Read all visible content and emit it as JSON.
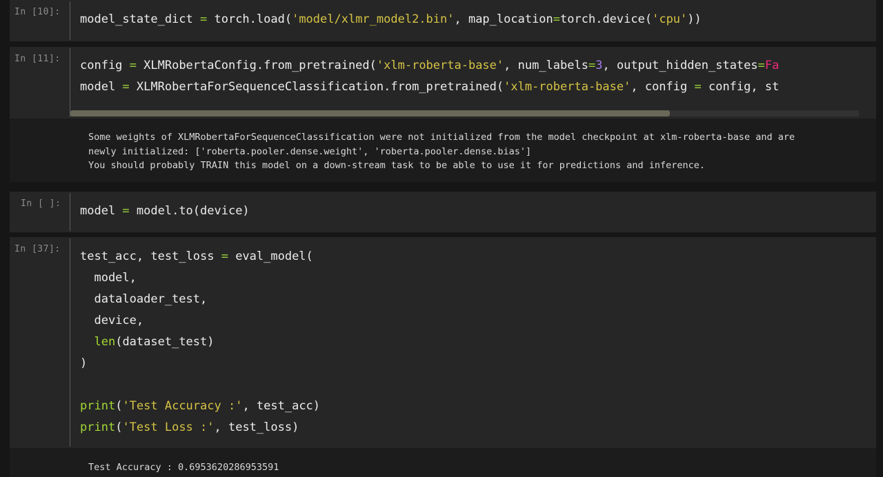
{
  "cells": [
    {
      "prompt": "In [10]:",
      "lines": [
        [
          [
            "t",
            "model_state_dict "
          ],
          [
            "op",
            "="
          ],
          [
            "t",
            " torch.load("
          ],
          [
            "str",
            "'model/xlmr_model2.bin'"
          ],
          [
            "t",
            ", map_location"
          ],
          [
            "op",
            "="
          ],
          [
            "t",
            "torch.device("
          ],
          [
            "str",
            "'cpu'"
          ],
          [
            "t",
            "))"
          ]
        ]
      ]
    },
    {
      "prompt": "In [11]:",
      "lines": [
        [
          [
            "t",
            "config "
          ],
          [
            "op",
            "="
          ],
          [
            "t",
            " XLMRobertaConfig.from_pretrained("
          ],
          [
            "str",
            "'xlm-roberta-base'"
          ],
          [
            "t",
            ", num_labels"
          ],
          [
            "op",
            "="
          ],
          [
            "num",
            "3"
          ],
          [
            "t",
            ", output_hidden_states"
          ],
          [
            "op",
            "="
          ],
          [
            "kw",
            "Fa"
          ]
        ],
        [
          [
            "t",
            "model "
          ],
          [
            "op",
            "="
          ],
          [
            "t",
            " XLMRobertaForSequenceClassification.from_pretrained("
          ],
          [
            "str",
            "'xlm-roberta-base'"
          ],
          [
            "t",
            ", config "
          ],
          [
            "op",
            "="
          ],
          [
            "t",
            " config, st"
          ]
        ]
      ],
      "scrollbar_fraction": 0.76,
      "output": [
        "Some weights of XLMRobertaForSequenceClassification were not initialized from the model checkpoint at xlm-roberta-base and are",
        "newly initialized: ['roberta.pooler.dense.weight', 'roberta.pooler.dense.bias']",
        "You should probably TRAIN this model on a down-stream task to be able to use it for predictions and inference."
      ]
    },
    {
      "prompt": "In [ ]:",
      "lines": [
        [
          [
            "t",
            "model "
          ],
          [
            "op",
            "="
          ],
          [
            "t",
            " model.to(device)"
          ]
        ]
      ]
    },
    {
      "prompt": "In [37]:",
      "lines": [
        [
          [
            "t",
            "test_acc, test_loss "
          ],
          [
            "op",
            "="
          ],
          [
            "t",
            " eval_model("
          ]
        ],
        [
          [
            "t",
            "  model,"
          ]
        ],
        [
          [
            "t",
            "  dataloader_test,"
          ]
        ],
        [
          [
            "t",
            "  device,"
          ]
        ],
        [
          [
            "t",
            "  "
          ],
          [
            "fn",
            "len"
          ],
          [
            "t",
            "(dataset_test)"
          ]
        ],
        [
          [
            "t",
            ")"
          ]
        ],
        [
          [
            "t",
            ""
          ]
        ],
        [
          [
            "fn",
            "print"
          ],
          [
            "t",
            "("
          ],
          [
            "str",
            "'Test Accuracy :'"
          ],
          [
            "t",
            ", test_acc)"
          ]
        ],
        [
          [
            "fn",
            "print"
          ],
          [
            "t",
            "("
          ],
          [
            "str",
            "'Test Loss :'"
          ],
          [
            "t",
            ", test_loss)"
          ]
        ]
      ],
      "output": [
        "Test Accuracy : 0.6953620286953591"
      ]
    }
  ],
  "colors": {
    "operator": "#9bd23b",
    "string": "#d5c344",
    "builtin": "#a3d934",
    "number": "#a37ef0",
    "keyword": "#ee2a78"
  }
}
